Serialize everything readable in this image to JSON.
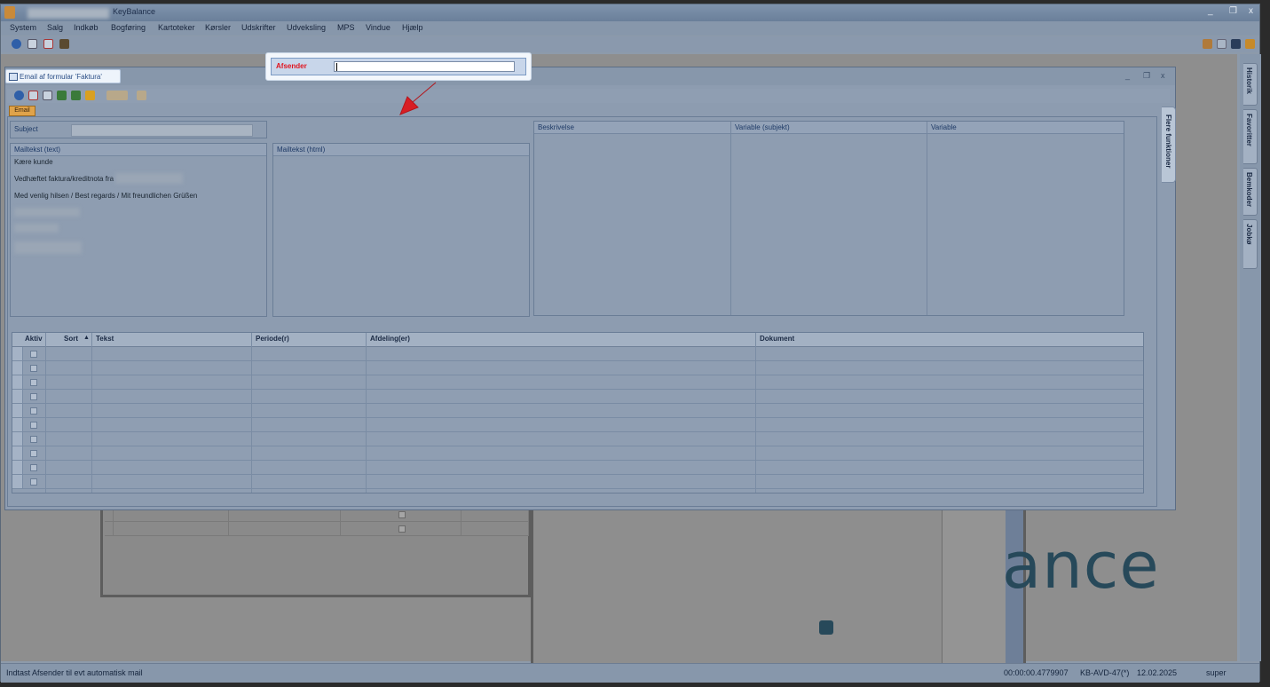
{
  "app": {
    "title": "KeyBalance",
    "window_controls": {
      "minimize": "_",
      "restore": "❐",
      "close": "x"
    }
  },
  "menu": [
    "System",
    "Salg",
    "Indkøb",
    "Bogføring",
    "Kartoteker",
    "Kørsler",
    "Udskrifter",
    "Udveksling",
    "MPS",
    "Vindue",
    "Hjælp"
  ],
  "toolbar_icons": [
    "help-icon",
    "calendar-icon",
    "calendar-edit-icon",
    "ship-icon"
  ],
  "right_rail_tabs": [
    "Historik",
    "Favoritter",
    "Bemkoder",
    "Jobkø"
  ],
  "email_window": {
    "title": "Email af formular 'Faktura'",
    "controls": {
      "minimize": "_",
      "maximize": "❐",
      "close": "x"
    },
    "tab": "Email",
    "subject_label": "Subject",
    "subject_value": "",
    "afsender_label": "Afsender",
    "afsender_value": "",
    "mailtekst_text_label": "Mailtekst (text)",
    "mailtekst_html_label": "Mailtekst (html)",
    "mail_lines": [
      "Kære kunde",
      "Vedhæftet faktura/kreditnota fra",
      "Med venlig hilsen / Best regards / Mit freundlichen Grüßen"
    ],
    "var_columns": [
      "Beskrivelse",
      "Variable (subjekt)",
      "Variable"
    ],
    "side_tab": "Flere funktioner",
    "grid": {
      "columns": [
        "Aktiv",
        "Sort",
        "Tekst",
        "Periode(r)",
        "Afdeling(er)",
        "Dokument"
      ],
      "sort_indicator": "▲",
      "row_count": 10
    }
  },
  "background": {
    "brand_text": "ance"
  },
  "status": {
    "hint": "Indtast Afsender til evt automatisk mail",
    "timer": "00:00:00.4779907",
    "machine": "KB-AVD-47(*)",
    "date": "12.02.2025",
    "user": "super"
  },
  "colors": {
    "accent_red": "#e0141e",
    "tab_orange": "#e0a34a",
    "brand_teal": "#27495a"
  }
}
